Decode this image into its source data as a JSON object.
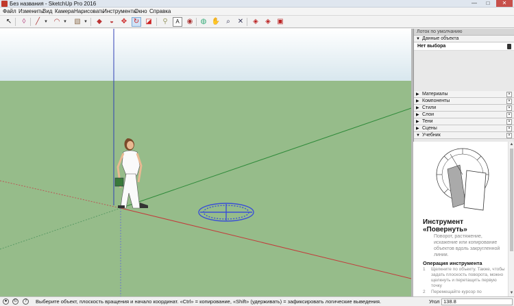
{
  "window": {
    "title": "Без названия - SketchUp Pro 2016",
    "minimize": "—",
    "maximize": "□",
    "close": "✕"
  },
  "menu": [
    "Файл",
    "Изменить",
    "Вид",
    "Камера",
    "Нарисовать",
    "Инструменты",
    "Окно",
    "Справка"
  ],
  "toolbar": {
    "tools": [
      {
        "name": "select",
        "glyph": "↖"
      },
      {
        "name": "eraser",
        "glyph": "◊"
      },
      {
        "name": "line",
        "glyph": "╱"
      },
      {
        "name": "arc",
        "glyph": "◠"
      },
      {
        "name": "rectangle",
        "glyph": "▧"
      },
      {
        "name": "push-pull",
        "glyph": "◆"
      },
      {
        "name": "offset",
        "glyph": "◒"
      },
      {
        "name": "move",
        "glyph": "✥"
      },
      {
        "name": "rotate",
        "glyph": "↻",
        "active": true
      },
      {
        "name": "scale",
        "glyph": "◪"
      },
      {
        "name": "tape-measure",
        "glyph": "⚲"
      },
      {
        "name": "text",
        "glyph": "A"
      },
      {
        "name": "paint-bucket",
        "glyph": "◉"
      },
      {
        "name": "orbit",
        "glyph": "◍"
      },
      {
        "name": "pan",
        "glyph": "✋"
      },
      {
        "name": "zoom",
        "glyph": "⌕"
      },
      {
        "name": "zoom-extents",
        "glyph": "✕"
      },
      {
        "name": "3d-warehouse",
        "glyph": "◈"
      },
      {
        "name": "extension-warehouse",
        "glyph": "◈"
      },
      {
        "name": "layout",
        "glyph": "▣"
      }
    ]
  },
  "tray": {
    "title": "Лоток по умолчанию",
    "entity_info": {
      "title": "Данные объекта",
      "selection": "Нет выбора"
    },
    "panels": [
      "Материалы",
      "Компоненты",
      "Стили",
      "Слои",
      "Тени",
      "Сцены"
    ],
    "tutorial": {
      "title": "Учебник",
      "heading": "Инструмент «Повернуть»",
      "description": "Поворот, растяжение, искажение или копирование объектов вдоль закругленной линии.",
      "subheading": "Операция инструмента",
      "steps": [
        {
          "n": "1",
          "text": "Щелкните по объекту. Также, чтобы задать плоскость поворота, можно щелкнуть и перетащить первую точку"
        },
        {
          "n": "2",
          "text": "Перемещайте курсор по"
        }
      ]
    }
  },
  "statusbar": {
    "message": "Выберите объект, плоскость вращения и начало координат. «Ctrl» = копирование, «Shift» (удерживать) = зафиксировать логические выведения.",
    "vcb_label": "Угол",
    "vcb_value": "138.8"
  },
  "colors": {
    "sky": "#ffffff",
    "sky_bottom": "#d8e7ee",
    "ground": "#96bc8a",
    "axis_red": "#c33a3a",
    "axis_green": "#2f8a3a",
    "axis_blue": "#2f3fb5",
    "protractor": "#3a4fd6",
    "selection_blue": "#cfe3f7"
  }
}
